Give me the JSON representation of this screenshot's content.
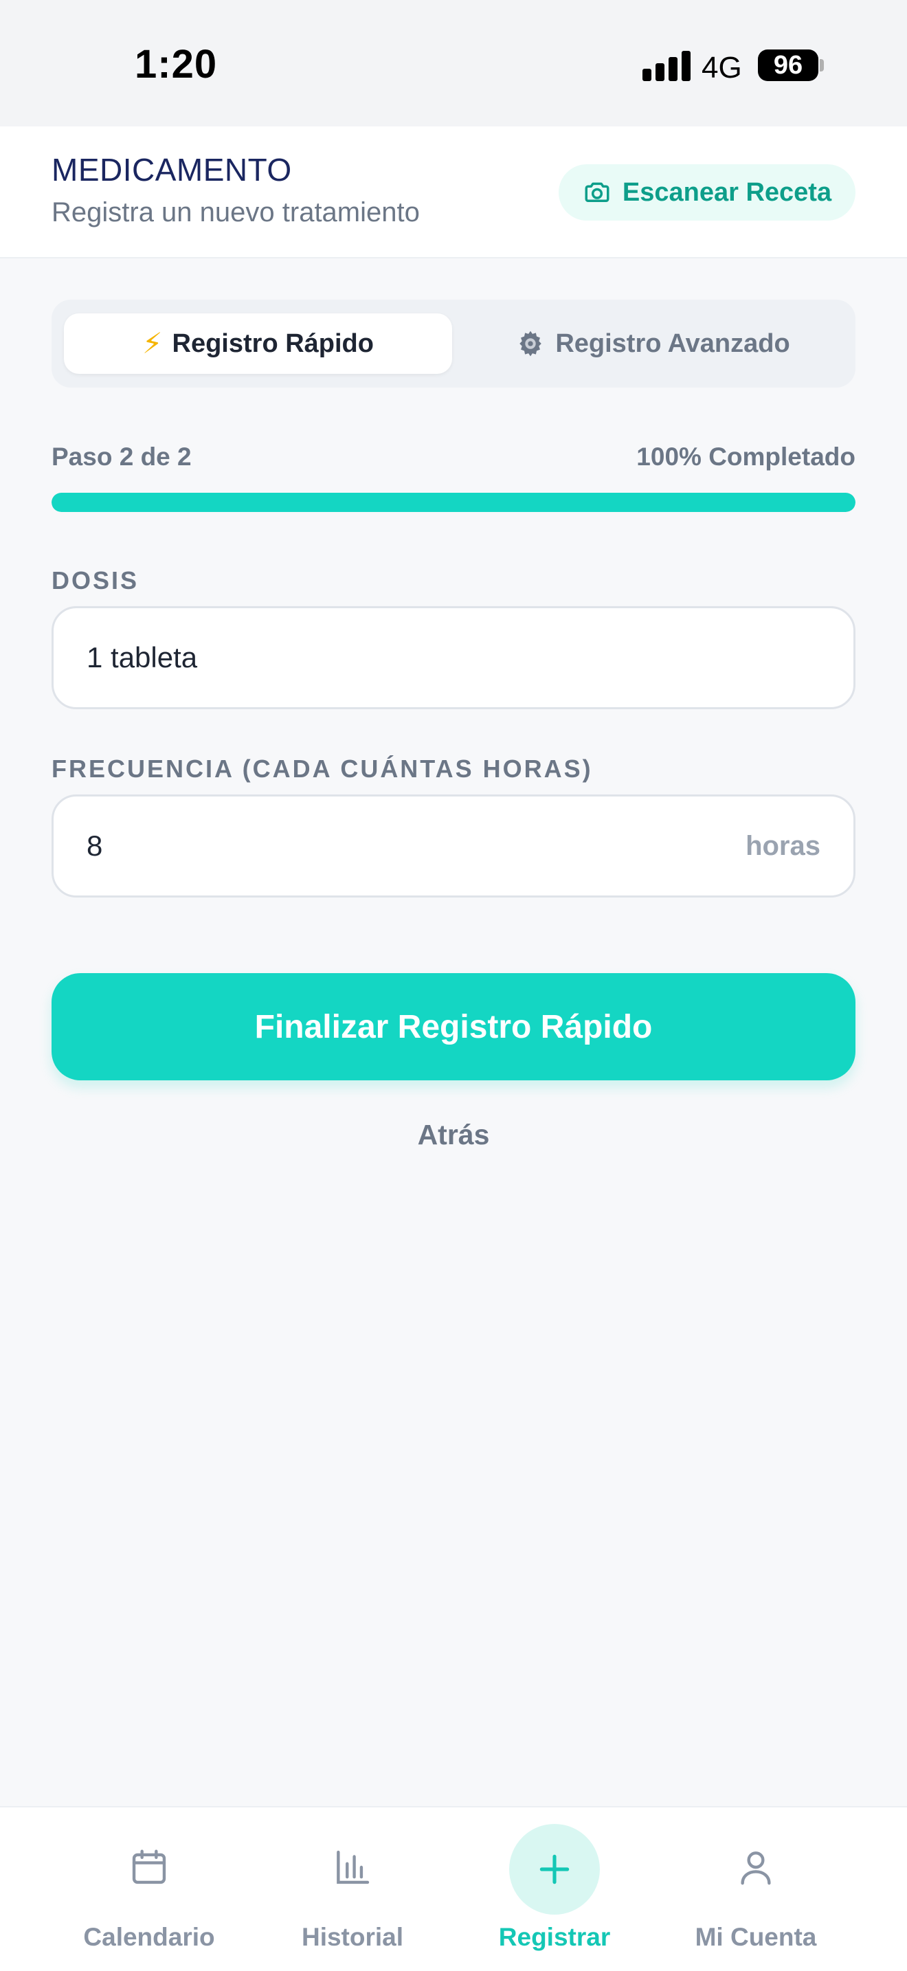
{
  "status_bar": {
    "time": "1:20",
    "network": "4G",
    "battery": "96"
  },
  "header": {
    "title": "MEDICAMENTO",
    "subtitle": "Registra un nuevo tratamiento",
    "scan_button": {
      "label": "Escanear Receta",
      "icon": "camera-icon"
    }
  },
  "mode_tabs": [
    {
      "label": "Registro Rápido",
      "icon": "lightning-icon",
      "active": true
    },
    {
      "label": "Registro Avanzado",
      "icon": "gear-icon",
      "active": false
    }
  ],
  "progress": {
    "step_label": "Paso 2 de 2",
    "percent_label": "100% Completado",
    "fraction": 1.0
  },
  "form": {
    "dose": {
      "label": "DOSIS",
      "value": "1 tableta"
    },
    "frequency": {
      "label": "FRECUENCIA (CADA CUÁNTAS HORAS)",
      "value": "8",
      "suffix": "horas"
    }
  },
  "actions": {
    "submit_label": "Finalizar Registro Rápido",
    "back_label": "Atrás"
  },
  "bottom_nav": [
    {
      "label": "Calendario",
      "icon": "calendar-icon",
      "active": false
    },
    {
      "label": "Historial",
      "icon": "bar-chart-icon",
      "active": false
    },
    {
      "label": "Registrar",
      "icon": "plus-icon",
      "active": true
    },
    {
      "label": "Mi Cuenta",
      "icon": "user-icon",
      "active": false
    }
  ],
  "colors": {
    "accent": "#14d6c3",
    "accent_dark": "#0d9e8a",
    "title": "#1a2660",
    "muted": "#6b7686",
    "nav_inactive": "#8a94a4"
  }
}
